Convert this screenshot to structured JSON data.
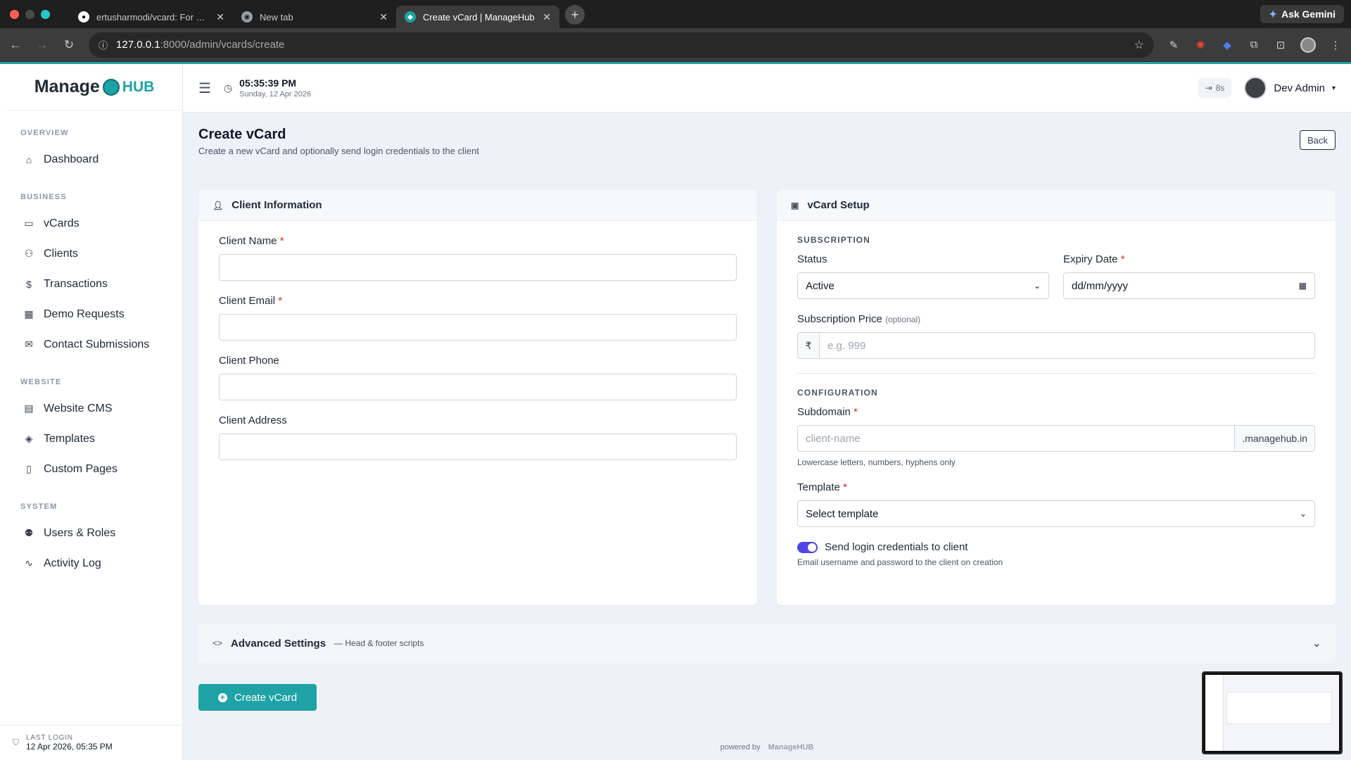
{
  "browser": {
    "tabs": [
      {
        "title": "ertusharmodi/vcard: For man",
        "favicon": "github-icon",
        "active": false
      },
      {
        "title": "New tab",
        "favicon": "chrome-icon",
        "active": false
      },
      {
        "title": "Create vCard | ManageHub",
        "favicon": "managehub-icon",
        "active": true
      }
    ],
    "url_host": "127.0.0.1",
    "url_path": ":8000/admin/vcards/create",
    "gemini_label": "Ask Gemini"
  },
  "brand": {
    "name_a": "Manage",
    "name_b": "HUB",
    "accent": "#1fa2a5"
  },
  "sidebar": {
    "sections": [
      {
        "label": "OVERVIEW",
        "items": [
          {
            "label": "Dashboard",
            "icon": "home-icon"
          }
        ]
      },
      {
        "label": "BUSINESS",
        "items": [
          {
            "label": "vCards",
            "icon": "card-icon"
          },
          {
            "label": "Clients",
            "icon": "users-icon"
          },
          {
            "label": "Transactions",
            "icon": "dollar-icon"
          },
          {
            "label": "Demo Requests",
            "icon": "calendar-icon"
          },
          {
            "label": "Contact Submissions",
            "icon": "mail-icon"
          }
        ]
      },
      {
        "label": "WEBSITE",
        "items": [
          {
            "label": "Website CMS",
            "icon": "layout-icon"
          },
          {
            "label": "Templates",
            "icon": "layers-icon"
          },
          {
            "label": "Custom Pages",
            "icon": "file-icon"
          }
        ]
      },
      {
        "label": "SYSTEM",
        "items": [
          {
            "label": "Users & Roles",
            "icon": "user-cog-icon"
          },
          {
            "label": "Activity Log",
            "icon": "activity-icon"
          }
        ]
      }
    ],
    "last_login_label": "LAST LOGIN",
    "last_login_value": "12 Apr 2026, 05:35 PM"
  },
  "topbar": {
    "time": "05:35:39 PM",
    "date": "Sunday, 12 Apr 2026",
    "timer": "8s",
    "user_name": "Dev Admin"
  },
  "page": {
    "title": "Create vCard",
    "subtitle": "Create a new vCard and optionally send login credentials to the client",
    "back_label": "Back"
  },
  "client_card": {
    "title": "Client Information",
    "fields": {
      "name_label": "Client Name",
      "email_label": "Client Email",
      "phone_label": "Client Phone",
      "address_label": "Client Address"
    }
  },
  "setup_card": {
    "title": "vCard Setup",
    "subscription_label": "SUBSCRIPTION",
    "status_label": "Status",
    "status_value": "Active",
    "expiry_label": "Expiry Date",
    "expiry_placeholder": "dd/mm/yyyy",
    "price_label": "Subscription Price",
    "price_optional": "(optional)",
    "currency": "₹",
    "price_placeholder": "e.g. 999",
    "configuration_label": "CONFIGURATION",
    "subdomain_label": "Subdomain",
    "subdomain_placeholder": "client-name",
    "subdomain_suffix": ".managehub.in",
    "subdomain_help": "Lowercase letters, numbers, hyphens only",
    "template_label": "Template",
    "template_value": "Select template",
    "send_credentials_label": "Send login credentials to client",
    "send_credentials_help": "Email username and password to the client on creation",
    "send_credentials_on": true
  },
  "advanced": {
    "title": "Advanced Settings",
    "subtitle": "— Head & footer scripts"
  },
  "create_button": "Create vCard",
  "footer": {
    "powered_by": "powered by",
    "brand_a": "Manage",
    "brand_b": "HUB"
  }
}
